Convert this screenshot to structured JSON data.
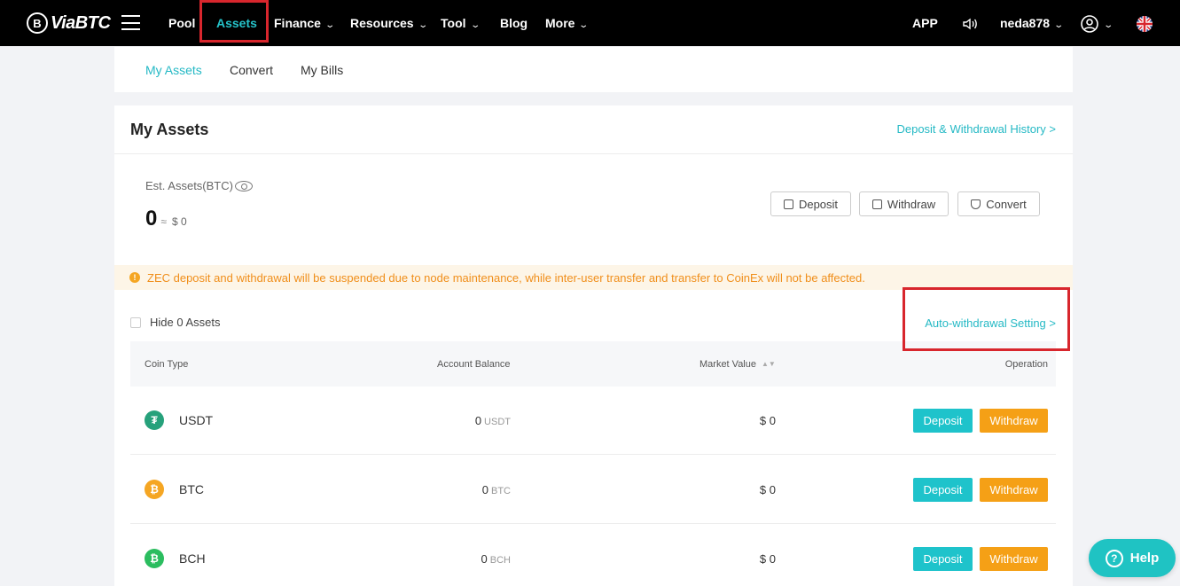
{
  "nav": {
    "logo_text": "ViaBTC",
    "logo_mark": "B",
    "items": [
      {
        "label": "Pool",
        "has_dropdown": false
      },
      {
        "label": "Assets",
        "has_dropdown": false,
        "active": true
      },
      {
        "label": "Finance",
        "has_dropdown": true
      },
      {
        "label": "Resources",
        "has_dropdown": true
      },
      {
        "label": "Tool",
        "has_dropdown": true
      },
      {
        "label": "Blog",
        "has_dropdown": false
      },
      {
        "label": "More",
        "has_dropdown": true
      }
    ],
    "app_label": "APP",
    "username": "neda878",
    "chevron": "⌄",
    "speaker_icon": "speaker-icon",
    "user_icon": "user-circle-icon",
    "flag_icon": "uk-flag-icon"
  },
  "subtabs": [
    "My Assets",
    "Convert",
    "My Bills"
  ],
  "assets": {
    "title": "My Assets",
    "history_link": "Deposit & Withdrawal History >",
    "est_label": "Est. Assets(BTC)",
    "est_value": "0",
    "approx": "≈",
    "est_usd": "$ 0",
    "buttons": {
      "deposit": "Deposit",
      "withdraw": "Withdraw",
      "convert": "Convert"
    },
    "notice_icon": "!",
    "notice": "ZEC deposit and withdrawal will be suspended due to node maintenance, while inter-user transfer and transfer to CoinEx will not be affected.",
    "hide_zero": "Hide 0 Assets",
    "auto_withdrawal": "Auto-withdrawal Setting >"
  },
  "table": {
    "headers": {
      "coin": "Coin Type",
      "balance": "Account Balance",
      "market": "Market Value",
      "operation": "Operation"
    },
    "sort_icon": "▲▼",
    "rows": [
      {
        "coin": "USDT",
        "symbol": "₮",
        "color": "#26a17b",
        "balance": "0",
        "unit": "USDT",
        "market": "$ 0",
        "deposit": "Deposit",
        "withdraw": "Withdraw"
      },
      {
        "coin": "BTC",
        "symbol": "₿",
        "color": "#f5a623",
        "balance": "0",
        "unit": "BTC",
        "market": "$ 0",
        "deposit": "Deposit",
        "withdraw": "Withdraw"
      },
      {
        "coin": "BCH",
        "symbol": "₿",
        "color": "#2bbd5f",
        "balance": "0",
        "unit": "BCH",
        "market": "$ 0",
        "deposit": "Deposit",
        "withdraw": "Withdraw"
      }
    ]
  },
  "help": {
    "label": "Help",
    "icon": "?"
  },
  "colors": {
    "accent": "#25b9c5",
    "withdraw": "#f5a016",
    "highlight_box": "#d8262d",
    "notice": "#f08e1a"
  }
}
